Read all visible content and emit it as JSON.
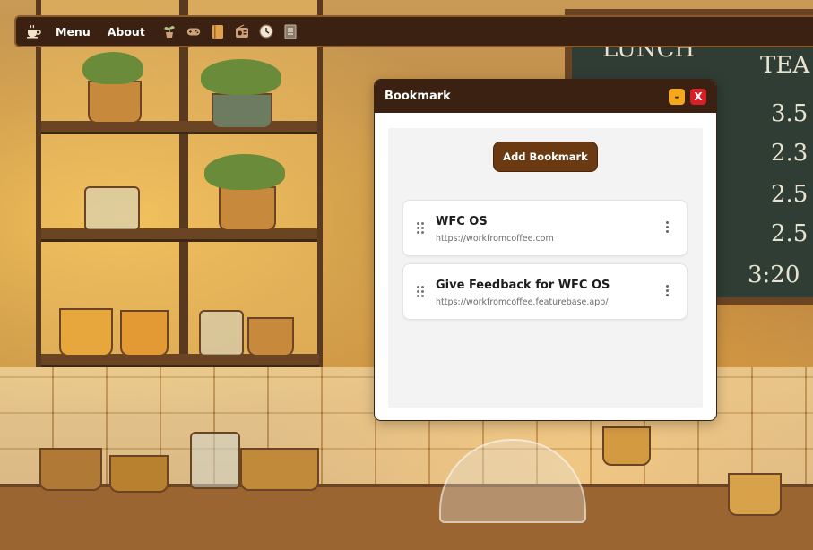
{
  "taskbar": {
    "logo_icon": "coffee-cup-icon",
    "menu_label": "Menu",
    "about_label": "About",
    "icons": [
      "plant-icon",
      "gamepad-icon",
      "notebook-icon",
      "radio-icon",
      "clock-icon",
      "bookmark-list-icon"
    ]
  },
  "window": {
    "title": "Bookmark",
    "minimize_label": "-",
    "close_label": "X",
    "add_button_label": "Add Bookmark",
    "bookmarks": [
      {
        "title": "WFC OS",
        "url": "https://workfromcoffee.com"
      },
      {
        "title": "Give Feedback for WFC OS",
        "url": "https://workfromcoffee.featurebase.app/"
      }
    ]
  },
  "background": {
    "board_lines": [
      "LUNCH",
      "TEA",
      "3.5",
      "2.3",
      "2.5",
      "2.5",
      "3:20"
    ]
  },
  "colors": {
    "taskbar_bg": "#3a2112",
    "accent_button": "#6b3a12",
    "minimize": "#f4a81c",
    "close": "#d91f26"
  }
}
